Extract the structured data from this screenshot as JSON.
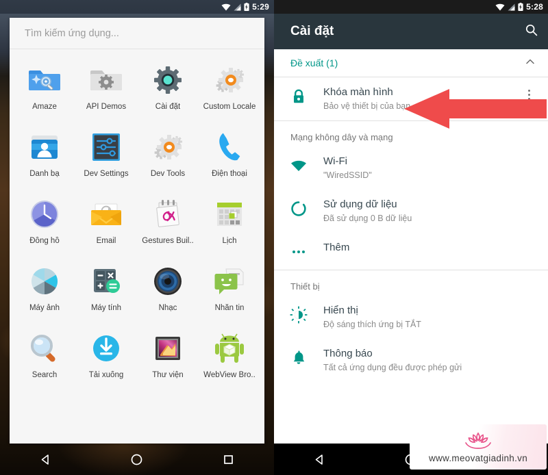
{
  "left_screen": {
    "status_bar": {
      "time": "5:29",
      "icons": [
        "wifi-icon",
        "signal-icon",
        "battery-charging-icon"
      ]
    },
    "search": {
      "placeholder": "Tìm kiếm ứng dụng..."
    },
    "apps": [
      {
        "label": "Amaze",
        "icon": "folder-search-icon"
      },
      {
        "label": "API Demos",
        "icon": "folder-gear-icon"
      },
      {
        "label": "Cài đặt",
        "icon": "settings-gear-icon"
      },
      {
        "label": "Custom Locale",
        "icon": "gears-orange-icon"
      },
      {
        "label": "Danh bạ",
        "icon": "contacts-icon"
      },
      {
        "label": "Dev Settings",
        "icon": "dev-settings-sliders-icon"
      },
      {
        "label": "Dev Tools",
        "icon": "gears-orange-icon"
      },
      {
        "label": "Điện thoại",
        "icon": "phone-icon"
      },
      {
        "label": "Đồng hồ",
        "icon": "clock-icon"
      },
      {
        "label": "Email",
        "icon": "email-envelope-icon"
      },
      {
        "label": "Gestures Buil..",
        "icon": "gesture-builder-icon"
      },
      {
        "label": "Lịch",
        "icon": "calendar-icon"
      },
      {
        "label": "Máy ảnh",
        "icon": "camera-aperture-icon"
      },
      {
        "label": "Máy tính",
        "icon": "calculator-icon"
      },
      {
        "label": "Nhạc",
        "icon": "music-speaker-icon"
      },
      {
        "label": "Nhắn tin",
        "icon": "messaging-icon"
      },
      {
        "label": "Search",
        "icon": "magnifier-icon"
      },
      {
        "label": "Tải xuống",
        "icon": "download-icon"
      },
      {
        "label": "Thư viện",
        "icon": "gallery-icon"
      },
      {
        "label": "WebView Bro..",
        "icon": "android-webview-icon"
      }
    ],
    "nav_bar": {
      "back": "back-triangle-icon",
      "home": "home-circle-icon",
      "recents": "recents-square-icon"
    }
  },
  "right_screen": {
    "status_bar": {
      "time": "5:28",
      "icons": [
        "wifi-icon",
        "signal-icon",
        "battery-charging-icon"
      ]
    },
    "app_bar": {
      "title": "Cài đặt",
      "search_icon": "search-icon"
    },
    "suggestions": {
      "header": "Đề xuất (1)",
      "collapse_icon": "chevron-up-icon",
      "items": [
        {
          "title": "Khóa màn hình",
          "subtitle": "Bảo vệ thiết bị của bạn",
          "icon": "lock-icon",
          "overflow": "kebab-menu-icon"
        }
      ]
    },
    "sections": [
      {
        "title": "Mạng không dây và mạng",
        "rows": [
          {
            "title": "Wi-Fi",
            "subtitle": "\"WiredSSID\"",
            "icon": "wifi-icon"
          },
          {
            "title": "Sử dụng dữ liệu",
            "subtitle": "Đã sử dụng 0 B dữ liệu",
            "icon": "data-usage-icon"
          },
          {
            "title": "Thêm",
            "subtitle": "",
            "icon": "more-dots-icon"
          }
        ]
      },
      {
        "title": "Thiết bị",
        "rows": [
          {
            "title": "Hiển thị",
            "subtitle": "Độ sáng thích ứng bị TẮT",
            "icon": "brightness-icon"
          },
          {
            "title": "Thông báo",
            "subtitle": "Tất cả ứng dụng đều được phép gửi",
            "icon": "bell-icon"
          }
        ]
      }
    ],
    "annotation": {
      "type": "red-arrow",
      "color": "#ef4b4b",
      "points_to": "Khóa màn hình"
    },
    "watermark": {
      "text": "www.meovatgiadinh.vn",
      "logo": "lotus-icon",
      "color": "#e8548a"
    },
    "nav_bar": {
      "back": "back-triangle-icon",
      "home": "home-circle-icon",
      "recents": "recents-square-icon"
    }
  },
  "colors": {
    "accent_teal": "#009688",
    "appbar": "#29363d",
    "arrow_red": "#ef4b4b",
    "watermark_pink": "#e8548a"
  }
}
